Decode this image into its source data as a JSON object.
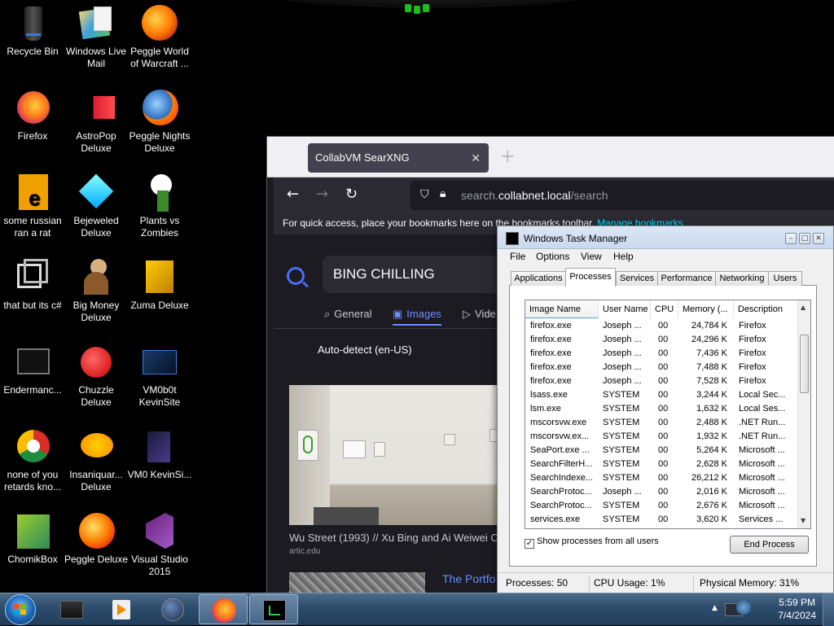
{
  "desktop": {
    "icons": [
      {
        "label": "Recycle Bin",
        "icon": "recycle-bin-icon"
      },
      {
        "label": "Windows Live Mail",
        "icon": "mail-icon"
      },
      {
        "label": "Peggle World of Warcraft ...",
        "icon": "peggle-wow-icon"
      },
      {
        "label": "Firefox",
        "icon": "firefox-icon"
      },
      {
        "label": "AstroPop Deluxe",
        "icon": "astropop-icon"
      },
      {
        "label": "Peggle Nights Deluxe",
        "icon": "peggle-nights-icon"
      },
      {
        "label": "some russian ran a rat",
        "icon": "file-icon"
      },
      {
        "label": "Bejeweled Deluxe",
        "icon": "bejeweled-icon"
      },
      {
        "label": "Plants vs Zombies",
        "icon": "pvz-icon"
      },
      {
        "label": "that but its c#",
        "icon": "stack-icon"
      },
      {
        "label": "Big Money Deluxe",
        "icon": "big-money-icon"
      },
      {
        "label": "Zuma Deluxe",
        "icon": "zuma-icon"
      },
      {
        "label": "Endermanc...",
        "icon": "enderman-icon"
      },
      {
        "label": "Chuzzle Deluxe",
        "icon": "chuzzle-icon"
      },
      {
        "label": "VM0b0t KevinSite",
        "icon": "vm-icon"
      },
      {
        "label": "none of you retards kno...",
        "icon": "chrome-icon"
      },
      {
        "label": "Insaniquar... Deluxe",
        "icon": "insaniquarium-icon"
      },
      {
        "label": "VM0 KevinSi...",
        "icon": "vm2-icon"
      },
      {
        "label": "ChomikBox",
        "icon": "chomik-icon"
      },
      {
        "label": "Peggle Deluxe",
        "icon": "peggle-icon"
      },
      {
        "label": "Visual Studio 2015",
        "icon": "vs-icon"
      }
    ]
  },
  "firefox": {
    "tab_title": "CollabVM SearXNG",
    "tab_close": "✕",
    "new_tab": "+",
    "url_domain_prefix": "search.",
    "url_domain": "collabnet.local",
    "url_path": "/search",
    "bookmarks_text": "For quick access, place your bookmarks here on the bookmarks toolbar.",
    "bookmarks_link": "Manage bookmarks...",
    "search_query": "BING CHILLING",
    "categories": [
      {
        "label": "General",
        "icon": "⌕"
      },
      {
        "label": "Images",
        "icon": "▣"
      },
      {
        "label": "Vide",
        "icon": "▷"
      }
    ],
    "language": "Auto-detect (en-US)",
    "result_title": "Wu Street (1993) // Xu Bing and Ai Weiwei C",
    "result_source": "artic.edu",
    "result2_link": "The Portfo"
  },
  "taskmgr": {
    "title": "Windows Task Manager",
    "menu": [
      "File",
      "Options",
      "View",
      "Help"
    ],
    "tabs": [
      "Applications",
      "Processes",
      "Services",
      "Performance",
      "Networking",
      "Users"
    ],
    "active_tab": "Processes",
    "columns": [
      "Image Name",
      "User Name",
      "CPU",
      "Memory (...",
      "Description"
    ],
    "rows": [
      [
        "firefox.exe",
        "Joseph ...",
        "00",
        "24,784 K",
        "Firefox"
      ],
      [
        "firefox.exe",
        "Joseph ...",
        "00",
        "24,296 K",
        "Firefox"
      ],
      [
        "firefox.exe",
        "Joseph ...",
        "00",
        "7,436 K",
        "Firefox"
      ],
      [
        "firefox.exe",
        "Joseph ...",
        "00",
        "7,488 K",
        "Firefox"
      ],
      [
        "firefox.exe",
        "Joseph ...",
        "00",
        "7,528 K",
        "Firefox"
      ],
      [
        "lsass.exe",
        "SYSTEM",
        "00",
        "3,244 K",
        "Local Sec..."
      ],
      [
        "lsm.exe",
        "SYSTEM",
        "00",
        "1,632 K",
        "Local Ses..."
      ],
      [
        "mscorsvw.exe",
        "SYSTEM",
        "00",
        "2,488 K",
        ".NET Run..."
      ],
      [
        "mscorsvw.ex...",
        "SYSTEM",
        "00",
        "1,932 K",
        ".NET Run..."
      ],
      [
        "SeaPort.exe ...",
        "SYSTEM",
        "00",
        "5,264 K",
        "Microsoft ..."
      ],
      [
        "SearchFilterH...",
        "SYSTEM",
        "00",
        "2,628 K",
        "Microsoft ..."
      ],
      [
        "SearchIndexe...",
        "SYSTEM",
        "00",
        "26,212 K",
        "Microsoft ..."
      ],
      [
        "SearchProtoc...",
        "Joseph ...",
        "00",
        "2,016 K",
        "Microsoft ..."
      ],
      [
        "SearchProtoc...",
        "SYSTEM",
        "00",
        "2,676 K",
        "Microsoft ..."
      ],
      [
        "services.exe",
        "SYSTEM",
        "00",
        "3,620 K",
        "Services ..."
      ]
    ],
    "show_all_label": "Show processes from all users",
    "show_all_checked": "✓",
    "end_process": "End Process",
    "status_processes": "Processes: 50",
    "status_cpu": "CPU Usage: 1%",
    "status_memory": "Physical Memory: 31%"
  },
  "taskbar": {
    "time": "5:59 PM",
    "date": "7/4/2024",
    "tray_arrow": "▲"
  }
}
